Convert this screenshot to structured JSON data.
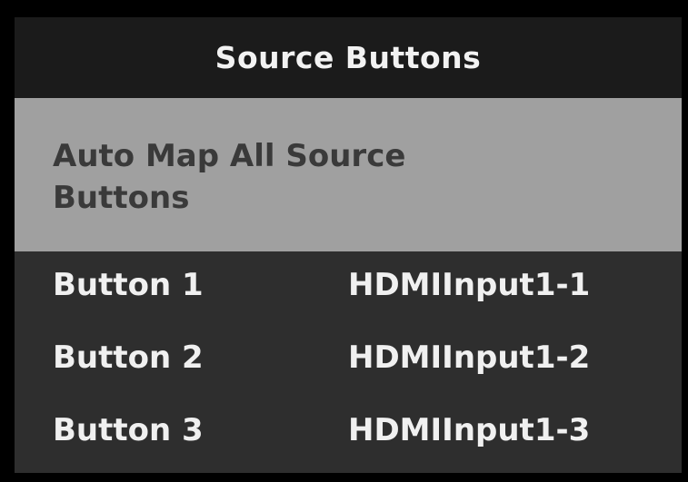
{
  "header": {
    "title": "Source Buttons"
  },
  "auto_map": {
    "label": "Auto Map All Source Buttons"
  },
  "buttons": [
    {
      "label": "Button 1",
      "source": "HDMIInput1-1"
    },
    {
      "label": "Button 2",
      "source": "HDMIInput1-2"
    },
    {
      "label": "Button 3",
      "source": "HDMIInput1-3"
    }
  ],
  "colors": {
    "outer_background": "#000000",
    "header_background": "#1b1b1b",
    "list_background": "#2e2e2e",
    "auto_map_background": "#a0a0a0",
    "auto_map_text": "#3a3a3a",
    "text": "#f0f0f0"
  }
}
